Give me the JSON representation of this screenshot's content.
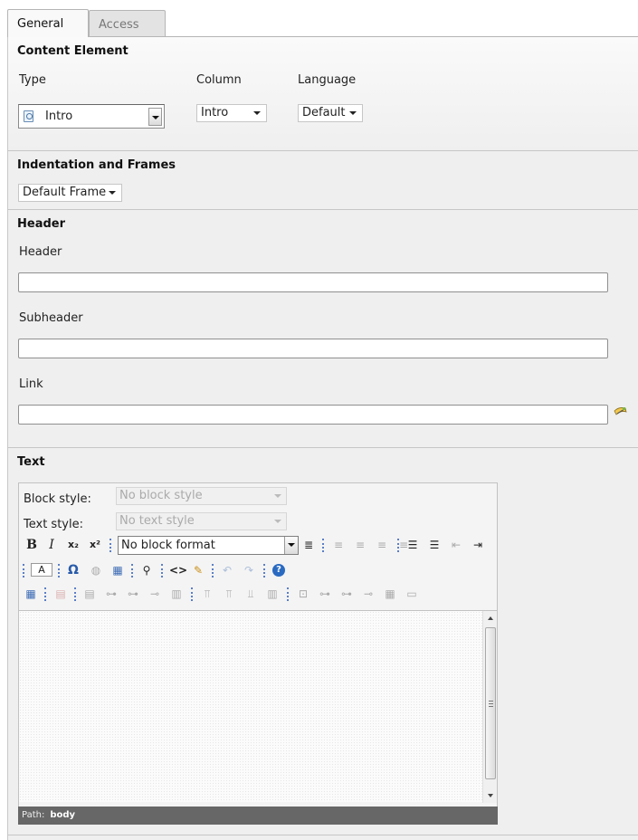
{
  "tabs": [
    {
      "label": "General",
      "active": true
    },
    {
      "label": "Access",
      "active": false
    }
  ],
  "content_element": {
    "title": "Content Element",
    "type_label": "Type",
    "type_value": "Intro",
    "column_label": "Column",
    "column_value": "Intro",
    "language_label": "Language",
    "language_value": "Default"
  },
  "frames": {
    "title": "Indentation and Frames",
    "frame_value": "Default Frame"
  },
  "header_section": {
    "title": "Header",
    "header_label": "Header",
    "header_value": "",
    "subheader_label": "Subheader",
    "subheader_value": "",
    "link_label": "Link",
    "link_value": ""
  },
  "text_section": {
    "title": "Text",
    "block_style_label": "Block style:",
    "block_style_value": "No block style",
    "text_style_label": "Text style:",
    "text_style_value": "No text style",
    "block_format_value": "No block format",
    "path_label": "Path:",
    "path_value": "body"
  },
  "colors": {
    "panel_bg": "#efefef",
    "pathbar_bg": "#676767",
    "separator": "#5b7fc7"
  }
}
